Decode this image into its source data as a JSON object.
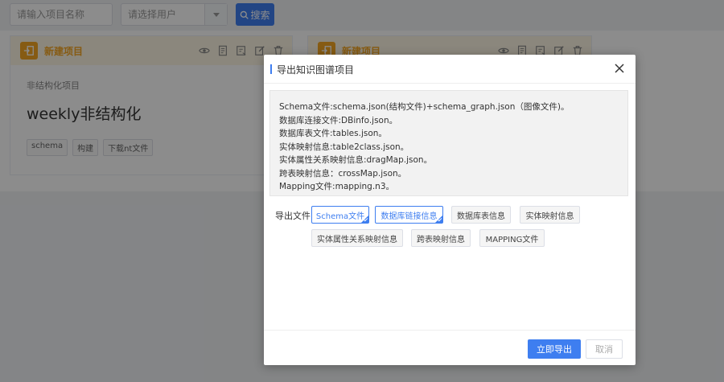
{
  "toolbar": {
    "project_placeholder": "请输入项目名称",
    "user_placeholder": "请选择用户",
    "search_label": "搜索"
  },
  "cards": [
    {
      "title": "新建项目",
      "type": "非结构化项目",
      "name": "weekly非结构化",
      "tags": [
        "schema",
        "构建",
        "下载nt文件"
      ]
    },
    {
      "title": "新建项目"
    }
  ],
  "dialog": {
    "title": "导出知识图谱项目",
    "info_lines": [
      "Schema文件:schema.json(结构文件)+schema_graph.json（图像文件)。",
      "数据库连接文件:DBinfo.json。",
      "数据库表文件:tables.json。",
      "实体映射信息:table2class.json。",
      "实体属性关系映射信息:dragMap.json。",
      "跨表映射信息：crossMap.json。",
      "Mapping文件:mapping.n3。"
    ],
    "export_label": "导出文件",
    "files": [
      {
        "label": "Schema文件",
        "selected": true
      },
      {
        "label": "数据库链接信息",
        "selected": true
      },
      {
        "label": "数据库表信息",
        "selected": false
      },
      {
        "label": "实体映射信息",
        "selected": false
      },
      {
        "label": "实体属性关系映射信息",
        "selected": false
      },
      {
        "label": "跨表映射信息",
        "selected": false
      },
      {
        "label": "MAPPING文件",
        "selected": false
      }
    ],
    "export_button": "立即导出",
    "cancel_button": "取消"
  },
  "colors": {
    "primary": "#3e7ef0",
    "card_accent": "#f5a623"
  }
}
